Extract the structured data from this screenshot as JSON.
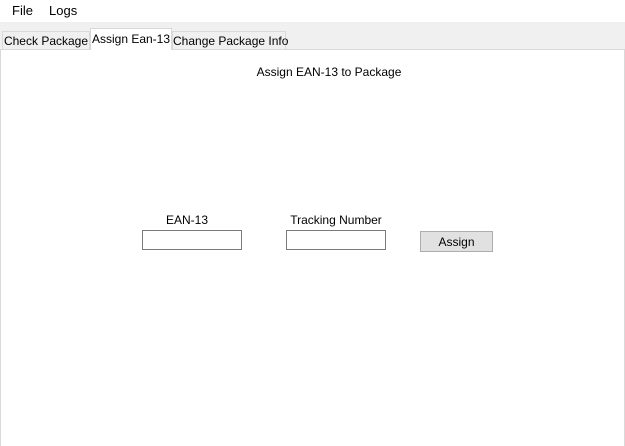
{
  "menu": {
    "file_label": "File",
    "logs_label": "Logs"
  },
  "tabs": [
    {
      "label": "Check Package",
      "selected": false
    },
    {
      "label": "Assign Ean-13",
      "selected": true
    },
    {
      "label": "Change Package Info",
      "selected": false
    }
  ],
  "assign_page": {
    "title": "Assign EAN-13 to Package",
    "ean_label": "EAN-13",
    "ean_value": "",
    "tracking_label": "Tracking Number",
    "tracking_value": "",
    "assign_button_label": "Assign"
  }
}
